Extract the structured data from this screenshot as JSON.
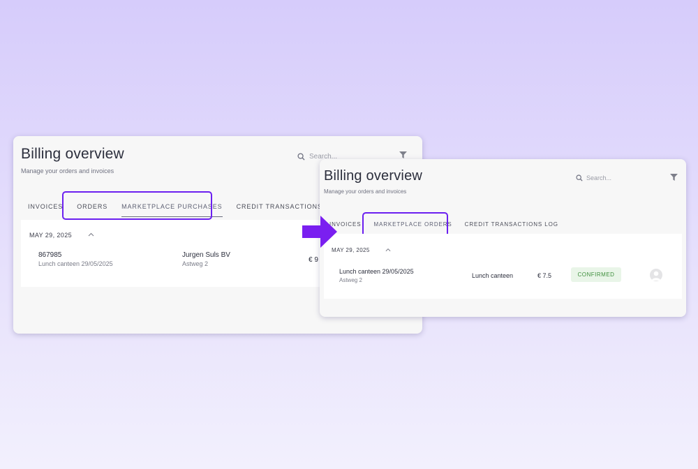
{
  "colors": {
    "accent": "#6b1ff0",
    "background_top": "#d6ccfb",
    "background_bottom": "#f2f0fd",
    "confirmed_bg": "#e9f5e8",
    "confirmed_text": "#3f8f3d"
  },
  "left_card": {
    "title": "Billing overview",
    "subtitle": "Manage your orders and invoices",
    "search_placeholder": "Search...",
    "tabs": [
      {
        "label": "INVOICES"
      },
      {
        "label": "ORDERS"
      },
      {
        "label": "MARKETPLACE PURCHASES",
        "active": true
      },
      {
        "label": "CREDIT TRANSACTIONS LOG"
      }
    ],
    "group_date": "MAY 29, 2025",
    "row": {
      "order_id": "867985",
      "description": "Lunch canteen 29/05/2025",
      "company": "Jurgen Suls BV",
      "address": "Astweg 2",
      "amount_partial": "€ 9"
    }
  },
  "right_card": {
    "title": "Billing overview",
    "subtitle": "Manage your orders and invoices",
    "search_placeholder": "Search...",
    "tabs": [
      {
        "label": "INVOICES"
      },
      {
        "label": "MARKETPLACE ORDERS",
        "active": true
      },
      {
        "label": "CREDIT TRANSACTIONS LOG"
      }
    ],
    "group_date": "MAY 29, 2025",
    "row": {
      "description": "Lunch canteen 29/05/2025",
      "address": "Astweg 2",
      "product": "Lunch canteen",
      "amount": "€ 7.5",
      "status": "CONFIRMED"
    }
  },
  "icons": {
    "search": "search-icon",
    "filter": "filter-icon",
    "collapse": "chevron-up-icon",
    "avatar": "user-avatar-icon",
    "transition": "arrow-right-icon"
  }
}
